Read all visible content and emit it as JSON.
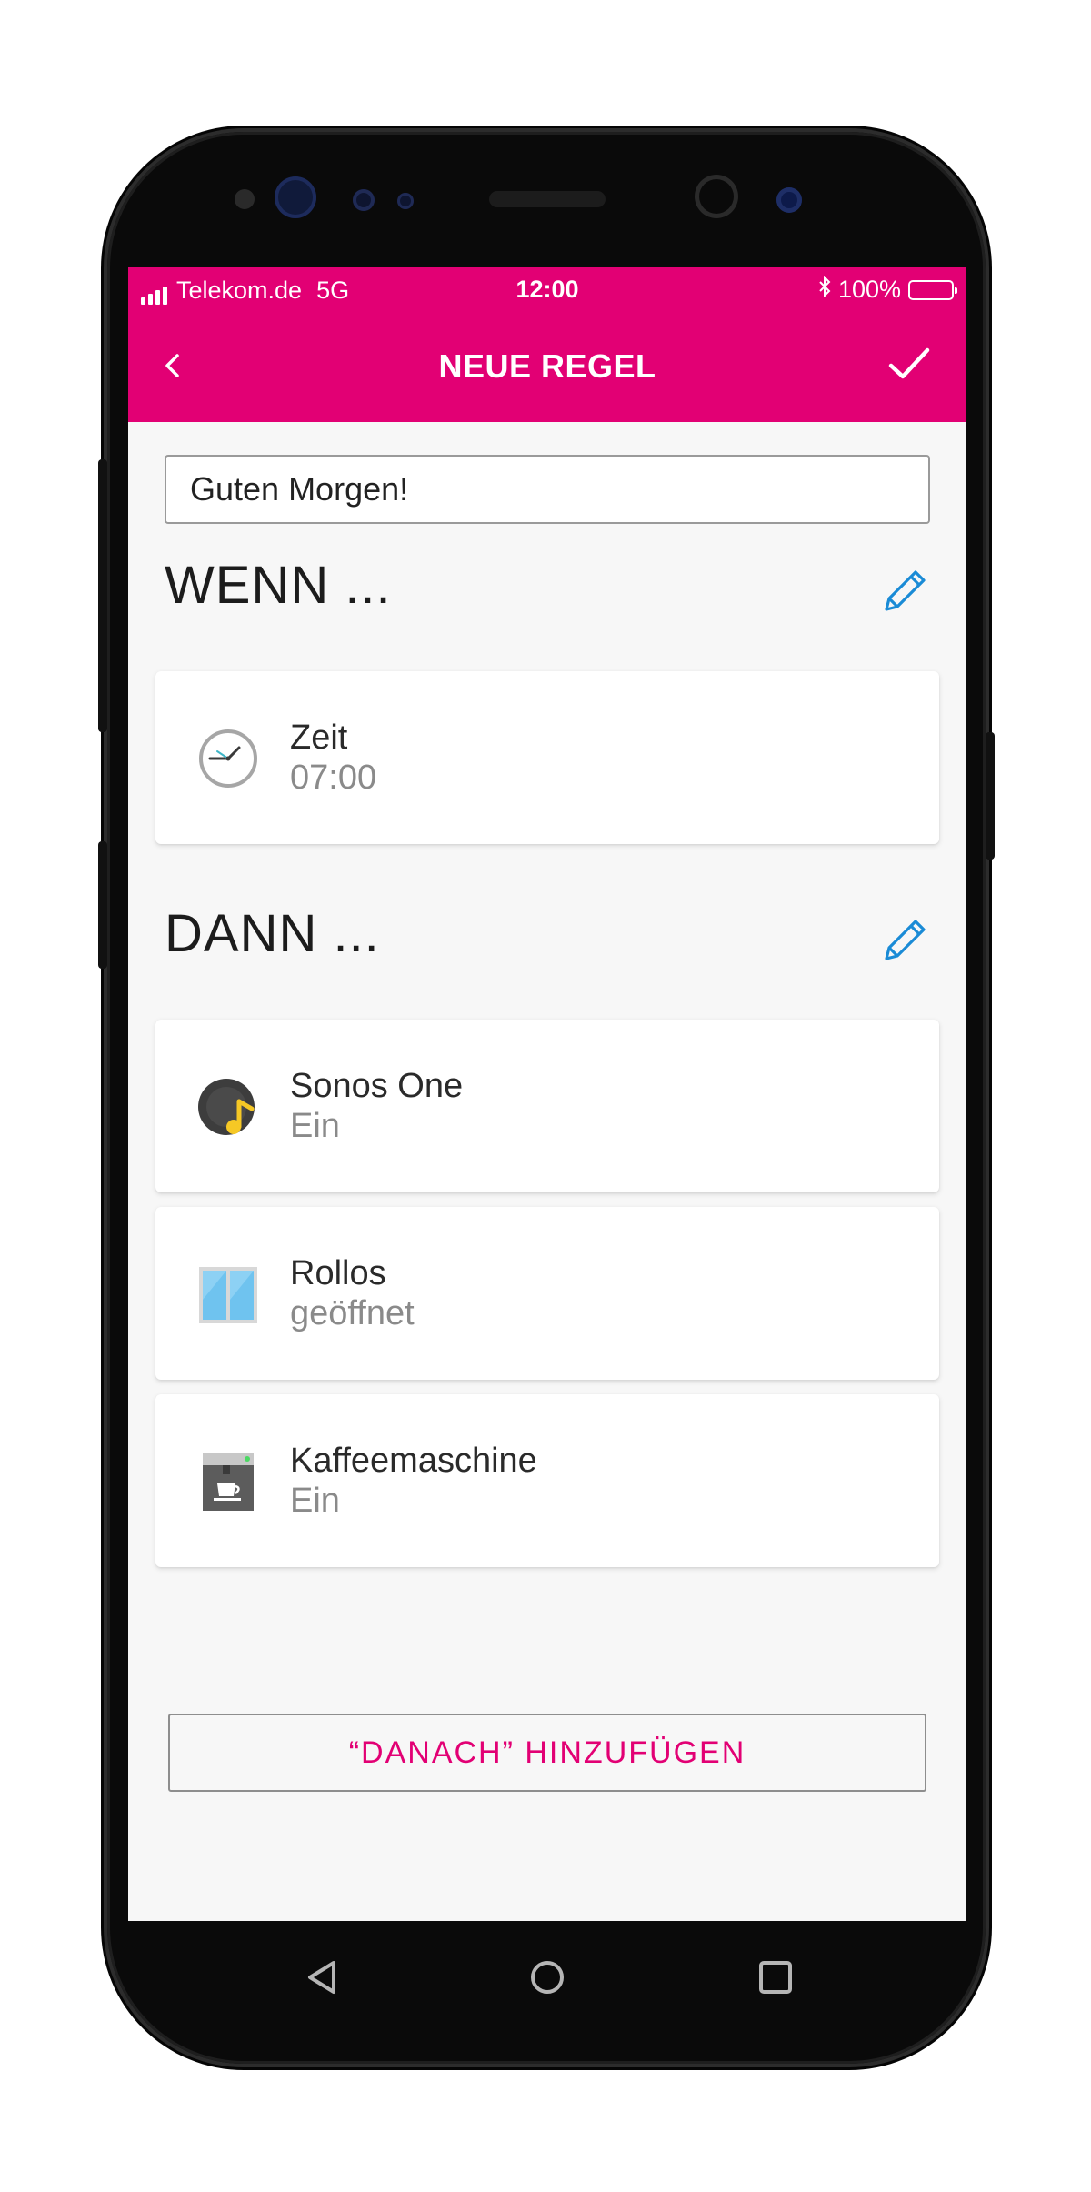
{
  "status_bar": {
    "carrier": "Telekom.de",
    "network": "5G",
    "time": "12:00",
    "battery": "100%"
  },
  "app_bar": {
    "title": "NEUE REGEL"
  },
  "rule_name": {
    "value": "Guten Morgen!"
  },
  "wenn": {
    "title": "WENN ...",
    "items": [
      {
        "label": "Zeit",
        "value": "07:00",
        "icon": "clock-icon"
      }
    ]
  },
  "dann": {
    "title": "DANN ...",
    "items": [
      {
        "label": "Sonos One",
        "value": "Ein",
        "icon": "speaker-music-icon"
      },
      {
        "label": "Rollos",
        "value": "geöffnet",
        "icon": "window-blinds-icon"
      },
      {
        "label": "Kaffeemaschine",
        "value": "Ein",
        "icon": "coffee-machine-icon"
      }
    ]
  },
  "add_button": {
    "label": "“DANACH” HINZUFÜGEN"
  },
  "colors": {
    "brand": "#e20074",
    "accent_edit": "#1a8bd6"
  }
}
